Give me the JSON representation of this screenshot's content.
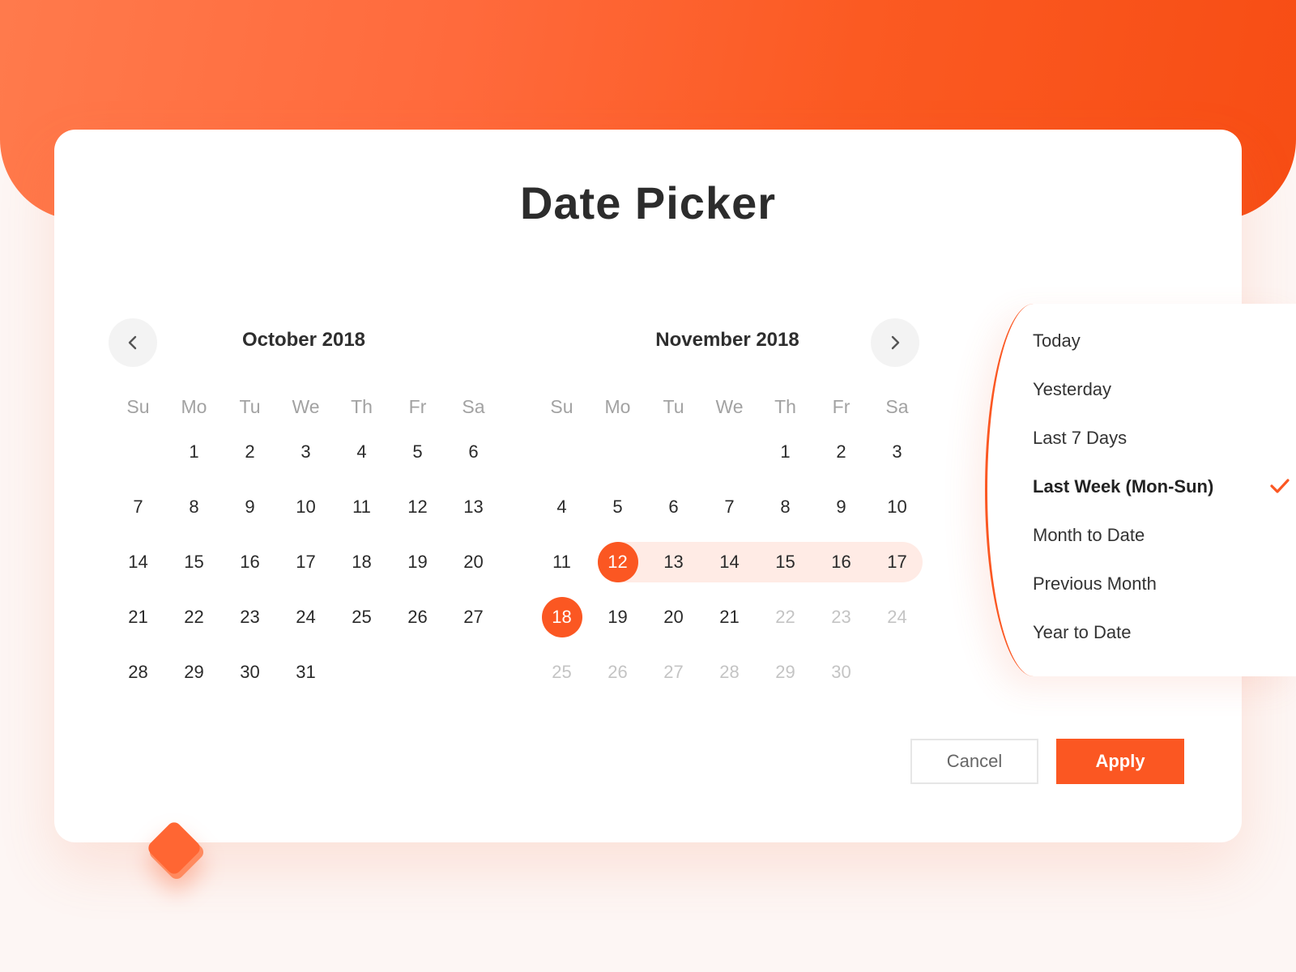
{
  "title": "Date Picker",
  "colors": {
    "accent": "#fb5722",
    "range": "#ffebe5",
    "text": "#2a2a2a",
    "muted": "#c4c4c4"
  },
  "nav": {
    "prev_icon": "chevron-left-icon",
    "next_icon": "chevron-right-icon"
  },
  "weekdays": [
    "Su",
    "Mo",
    "Tu",
    "We",
    "Th",
    "Fr",
    "Sa"
  ],
  "calendars": [
    {
      "title": "October 2018",
      "weeks": [
        [
          "",
          "1",
          "2",
          "3",
          "4",
          "5",
          "6"
        ],
        [
          "7",
          "8",
          "9",
          "10",
          "11",
          "12",
          "13"
        ],
        [
          "14",
          "15",
          "16",
          "17",
          "18",
          "19",
          "20"
        ],
        [
          "21",
          "22",
          "23",
          "24",
          "25",
          "26",
          "27"
        ],
        [
          "28",
          "29",
          "30",
          "31",
          "",
          "",
          ""
        ]
      ],
      "muted": []
    },
    {
      "title": "November 2018",
      "weeks": [
        [
          "",
          "",
          "",
          "",
          "1",
          "2",
          "3"
        ],
        [
          "4",
          "5",
          "6",
          "7",
          "8",
          "9",
          "10"
        ],
        [
          "11",
          "12",
          "13",
          "14",
          "15",
          "16",
          "17"
        ],
        [
          "18",
          "19",
          "20",
          "21",
          "22",
          "23",
          "24"
        ],
        [
          "25",
          "26",
          "27",
          "28",
          "29",
          "30",
          ""
        ]
      ],
      "muted": [
        "22",
        "23",
        "24",
        "25",
        "26",
        "27",
        "28",
        "29",
        "30"
      ],
      "selected": [
        "12",
        "18"
      ],
      "range": [
        "12",
        "13",
        "14",
        "15",
        "16",
        "17"
      ]
    }
  ],
  "presets": {
    "items": [
      "Today",
      "Yesterday",
      "Last 7 Days",
      "Last Week (Mon-Sun)",
      "Month to Date",
      "Previous Month",
      "Year to Date"
    ],
    "active_index": 3,
    "check_icon": "checkmark-icon"
  },
  "buttons": {
    "cancel": "Cancel",
    "apply": "Apply"
  }
}
